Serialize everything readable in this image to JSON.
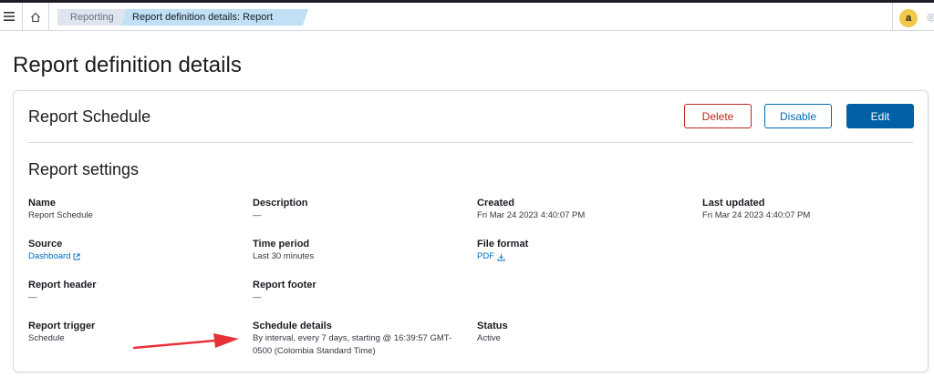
{
  "topbar": {
    "breadcrumbs": [
      "Reporting",
      "Report definition details: Report Schedule"
    ],
    "user_initial": "a"
  },
  "page": {
    "title": "Report definition details"
  },
  "panel": {
    "title": "Report Schedule",
    "buttons": {
      "delete": "Delete",
      "disable": "Disable",
      "edit": "Edit"
    },
    "colors": {
      "delete": "#bd271e",
      "disable": "#006bb8",
      "edit": "#0061a6"
    }
  },
  "settings": {
    "title": "Report settings",
    "name": {
      "label": "Name",
      "value": "Report Schedule"
    },
    "description": {
      "label": "Description",
      "value": "—"
    },
    "created": {
      "label": "Created",
      "value": "Fri Mar 24 2023 4:40:07 PM"
    },
    "last_updated": {
      "label": "Last updated",
      "value": "Fri Mar 24 2023 4:40:07 PM"
    },
    "source": {
      "label": "Source",
      "value": "Dashboard",
      "icon": "external-link-icon"
    },
    "time_period": {
      "label": "Time period",
      "value": "Last 30 minutes"
    },
    "file_format": {
      "label": "File format",
      "value": "PDF",
      "icon": "download-icon"
    },
    "report_header": {
      "label": "Report header",
      "value": "—"
    },
    "report_footer": {
      "label": "Report footer",
      "value": "—"
    },
    "report_trigger": {
      "label": "Report trigger",
      "value": "Schedule"
    },
    "schedule_details": {
      "label": "Schedule details",
      "value": "By interval, every 7 days, starting @ 16:39:57 GMT-0500 (Colombia Standard Time)"
    },
    "status": {
      "label": "Status",
      "value": "Active"
    }
  },
  "annotation": {
    "arrow_color": "#e8323a"
  }
}
